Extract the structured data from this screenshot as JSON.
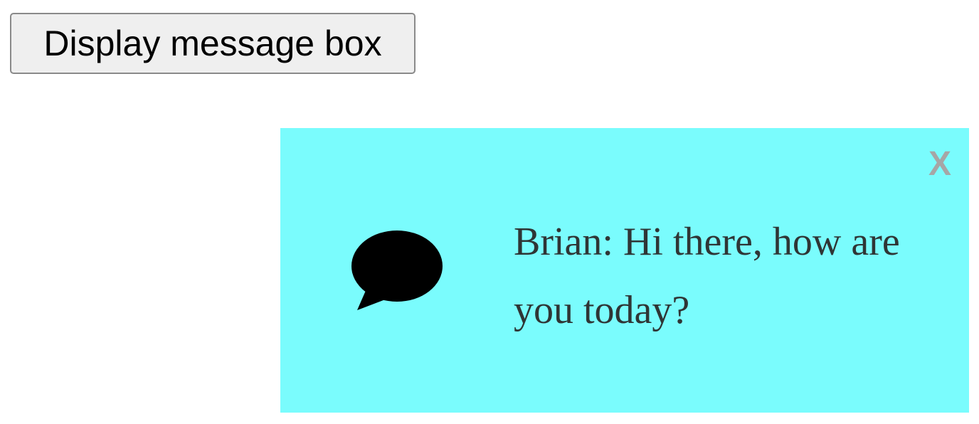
{
  "toolbar": {
    "display_button_label": "Display message box"
  },
  "message_box": {
    "close_label": "X",
    "message": "Brian: Hi there, how are you today?",
    "background_color": "#7afcfd",
    "icon": "speech-bubble-icon"
  }
}
